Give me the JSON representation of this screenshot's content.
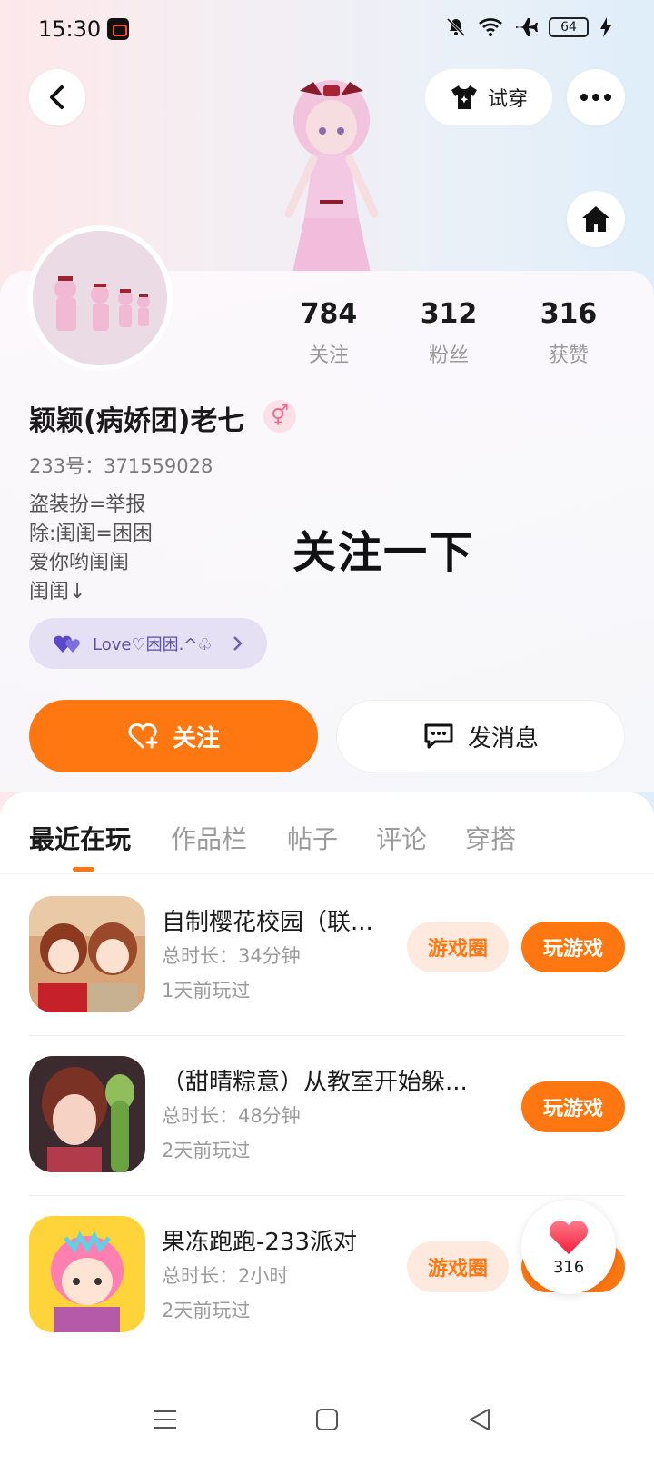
{
  "status_bar": {
    "time": "15:30",
    "battery": "64"
  },
  "header": {
    "tryon_label": "试穿"
  },
  "profile": {
    "stats": [
      {
        "num": "784",
        "label": "关注"
      },
      {
        "num": "312",
        "label": "粉丝"
      },
      {
        "num": "316",
        "label": "获赞"
      }
    ],
    "username": "颖颖(病娇团)老七",
    "gender_symbol": "⚥",
    "uid_text": "233号：371559028",
    "bio": [
      "盗装扮=举报",
      "除:闺闺=困困",
      "爱你哟闺闺",
      "闺闺↓"
    ],
    "overlay_text": "关注一下",
    "relation_pill": "Love♡困困.^♧",
    "follow_label": "关注",
    "message_label": "发消息"
  },
  "tabs": [
    "最近在玩",
    "作品栏",
    "帖子",
    "评论",
    "穿搭"
  ],
  "games": [
    {
      "title": "自制樱花校园（联...",
      "duration": "总时长：34分钟",
      "last_played": "1天前玩过",
      "circle_label": "游戏圈",
      "play_label": "玩游戏"
    },
    {
      "title": "（甜晴粽意）从教室开始躲...",
      "duration": "总时长：48分钟",
      "last_played": "2天前玩过",
      "circle_label": "",
      "play_label": "玩游戏"
    },
    {
      "title": "果冻跑跑-233派对",
      "duration": "总时长：2小时",
      "last_played": "2天前玩过",
      "circle_label": "游戏圈",
      "play_label": "玩游戏"
    }
  ],
  "floating_like": {
    "count": "316"
  },
  "colors": {
    "accent": "#ff7710",
    "accent_light": "#fde9de",
    "pill_bg": "#e5e0f3"
  }
}
